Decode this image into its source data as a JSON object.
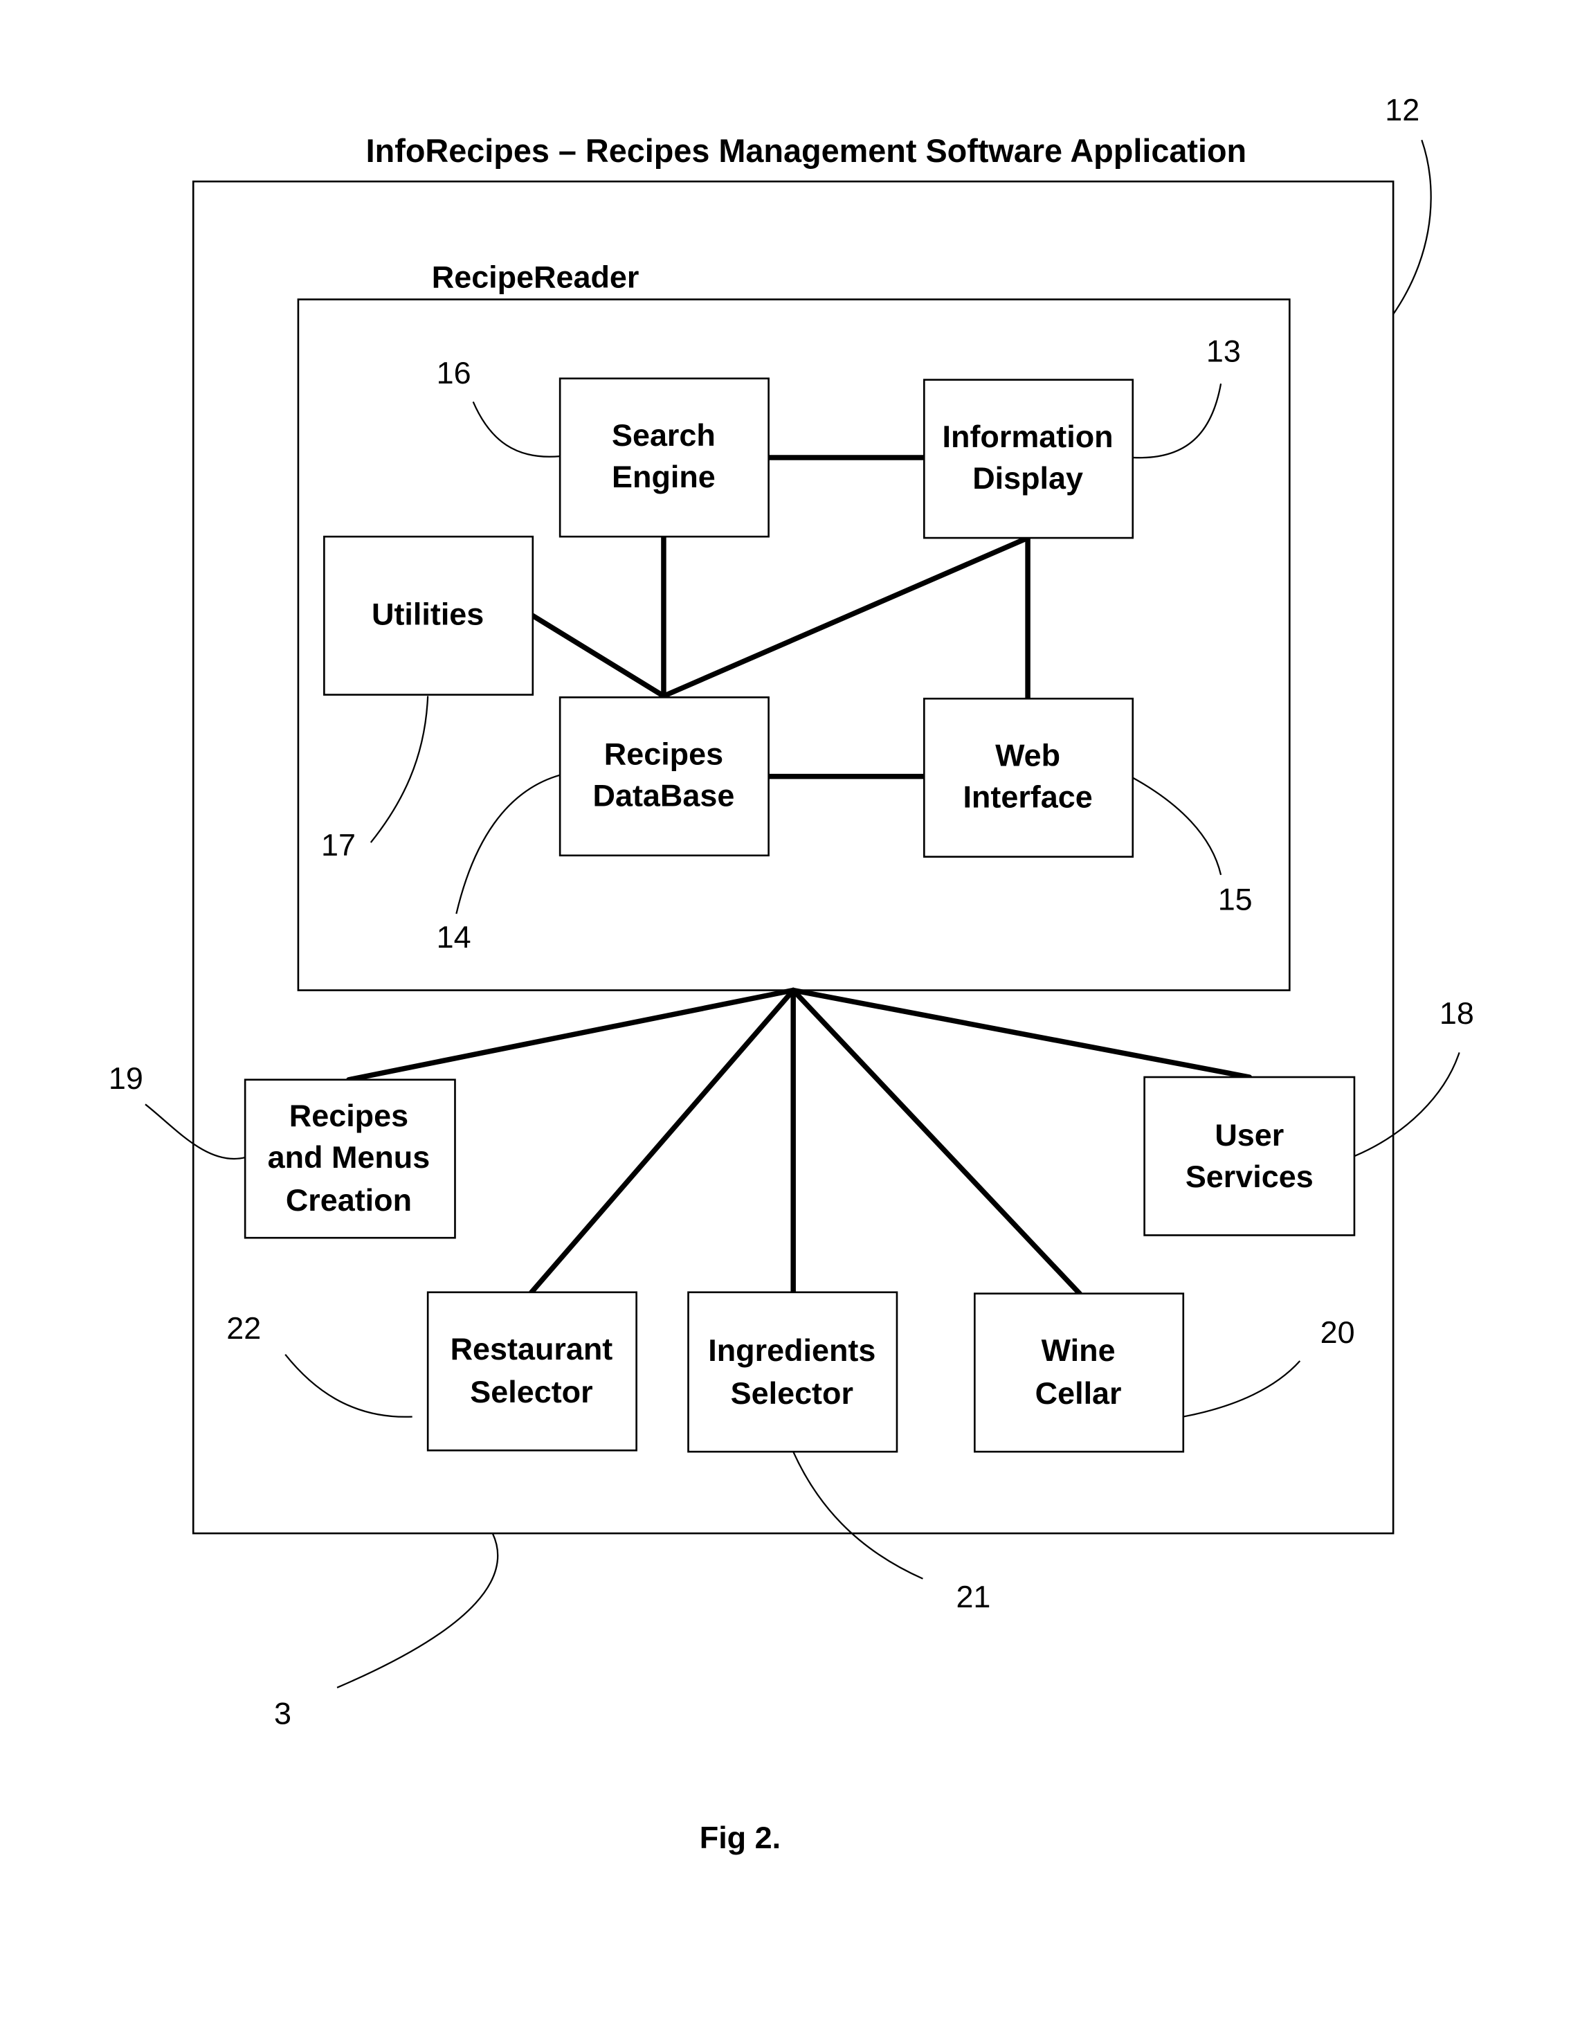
{
  "diagram": {
    "title": "InfoRecipes – Recipes Management Software Application",
    "title_ref": "12",
    "outer_ref": "3",
    "subsystem": {
      "label": "RecipeReader",
      "components": [
        {
          "id": "search-engine",
          "lines": [
            "Search",
            "Engine"
          ],
          "ref": "16"
        },
        {
          "id": "information-display",
          "lines": [
            "Information",
            "Display"
          ],
          "ref": "13"
        },
        {
          "id": "utilities",
          "lines": [
            "Utilities"
          ],
          "ref": "17"
        },
        {
          "id": "recipes-database",
          "lines": [
            "Recipes",
            "DataBase"
          ],
          "ref": "14"
        },
        {
          "id": "web-interface",
          "lines": [
            "Web",
            "Interface"
          ],
          "ref": "15"
        }
      ],
      "connections": [
        [
          "search-engine",
          "information-display"
        ],
        [
          "search-engine",
          "recipes-database"
        ],
        [
          "utilities",
          "recipes-database"
        ],
        [
          "information-display",
          "recipes-database"
        ],
        [
          "information-display",
          "web-interface"
        ],
        [
          "recipes-database",
          "web-interface"
        ]
      ]
    },
    "modules": [
      {
        "id": "recipes-menus-creation",
        "lines": [
          "Recipes",
          "and Menus",
          "Creation"
        ],
        "ref": "19"
      },
      {
        "id": "user-services",
        "lines": [
          "User",
          "Services"
        ],
        "ref": "18"
      },
      {
        "id": "restaurant-selector",
        "lines": [
          "Restaurant",
          "Selector"
        ],
        "ref": "22"
      },
      {
        "id": "ingredients-selector",
        "lines": [
          "Ingredients",
          "Selector"
        ],
        "ref": "21"
      },
      {
        "id": "wine-cellar",
        "lines": [
          "Wine",
          "Cellar"
        ],
        "ref": "20"
      }
    ],
    "caption": "Fig 2."
  }
}
